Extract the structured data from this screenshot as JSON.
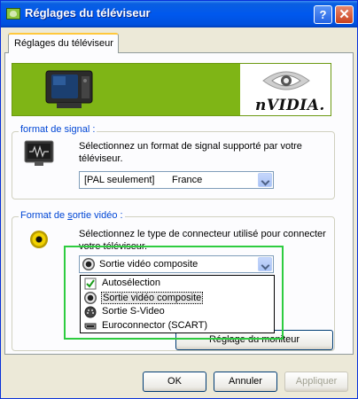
{
  "window": {
    "title": "Réglages du téléviseur",
    "help_label": "?",
    "close_label": "✕"
  },
  "tabs": [
    {
      "label": "Réglages du téléviseur",
      "active": true
    }
  ],
  "banner": {
    "brand": "nVIDIA."
  },
  "signal_group": {
    "legend": "format de signal :",
    "description": "Sélectionnez un format de signal supporté par votre téléviseur.",
    "select_value": "[PAL seulement]",
    "select_value_2": "France"
  },
  "output_group": {
    "legend_pre": "Format de ",
    "legend_underlined": "s",
    "legend_post": "ortie vidéo :",
    "description": "Sélectionnez le type de connecteur utilisé pour connecter votre téléviseur.",
    "select_value": "Sortie vidéo composite",
    "options": [
      {
        "label": "Autosélection",
        "icon": "check-icon"
      },
      {
        "label": "Sortie vidéo composite",
        "icon": "composite-connector-icon",
        "selected": true
      },
      {
        "label": "Sortie S-Video",
        "icon": "svideo-connector-icon"
      },
      {
        "label": "Euroconnector (SCART)",
        "icon": "scart-connector-icon"
      }
    ],
    "monitor_button": "Réglage du moniteur"
  },
  "footer": {
    "ok": "OK",
    "cancel": "Annuler",
    "apply": "Appliquer"
  },
  "colors": {
    "title_bar": "#0058ee",
    "banner_green": "#7fb516",
    "legend_blue": "#0046d5",
    "highlight_green": "#2ecc40"
  }
}
